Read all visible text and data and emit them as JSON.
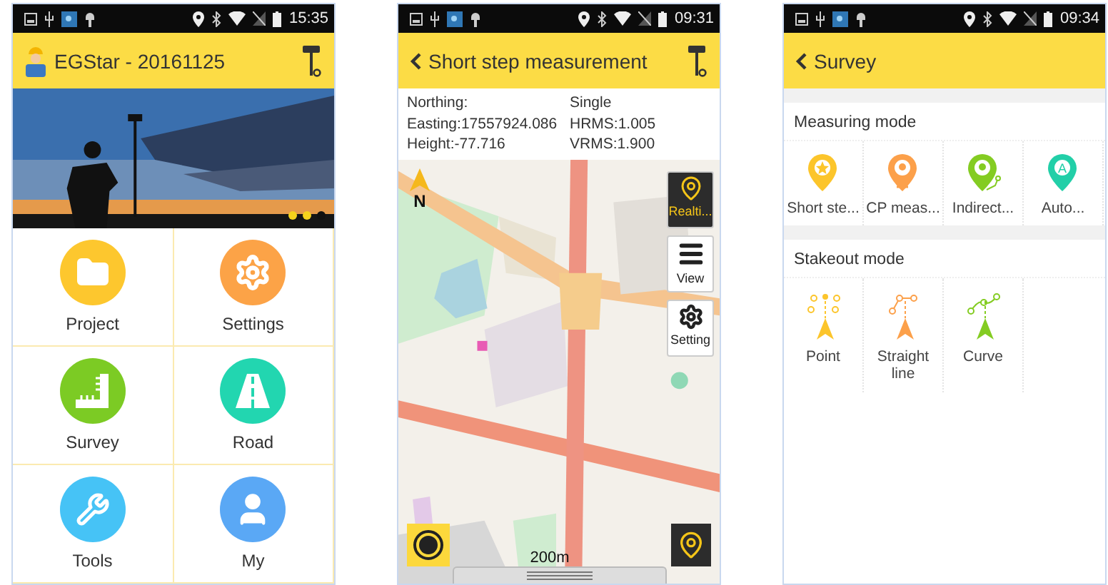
{
  "phones": [
    {
      "kind": "home",
      "status_time": "15:35",
      "title": "EGStar - 20161125",
      "carousel": [
        {
          "selected": false
        },
        {
          "selected": false
        },
        {
          "selected": true
        }
      ],
      "tiles": [
        {
          "label": "Project",
          "kind": "folder",
          "color": "#fdc72e"
        },
        {
          "label": "Settings",
          "kind": "gear",
          "color": "#fca347"
        },
        {
          "label": "Survey",
          "kind": "ruler",
          "color": "#7ccb24"
        },
        {
          "label": "Road",
          "kind": "road",
          "color": "#22d6b0"
        },
        {
          "label": "Tools",
          "kind": "tools",
          "color": "#46c3f6"
        },
        {
          "label": "My",
          "kind": "person",
          "color": "#5aa8f5"
        }
      ]
    },
    {
      "kind": "map",
      "status_time": "09:31",
      "title": "Short step measurement",
      "info": [
        {
          "left": "Northing:",
          "right": "Single"
        },
        {
          "left": "Easting:17557924.086",
          "right": "HRMS:1.005"
        },
        {
          "left": "Height:-77.716",
          "right": "VRMS:1.900"
        }
      ],
      "north": "N",
      "tools": [
        {
          "label": "Realti...",
          "kind": "pin",
          "selected": true
        },
        {
          "label": "View",
          "kind": "layers",
          "selected": false
        },
        {
          "label": "Setting",
          "kind": "gear",
          "selected": false
        }
      ],
      "scale": "200m"
    },
    {
      "kind": "menu",
      "status_time": "09:34",
      "title": "Survey",
      "sections": [
        {
          "title": "Measuring mode",
          "items": [
            {
              "label": "Short ste...",
              "kind": "star-pin",
              "color": "#fcc52b"
            },
            {
              "label": "CP meas...",
              "kind": "target-pin",
              "color": "#fca04a"
            },
            {
              "label": "Indirect...",
              "kind": "path-pin",
              "color": "#84cc22"
            },
            {
              "label": "Auto...",
              "kind": "letter-pin",
              "color": "#22cfa8",
              "letter": "A"
            }
          ]
        },
        {
          "title": "Stakeout mode",
          "items": [
            {
              "label": "Point",
              "kind": "point",
              "color": "#fcc52b"
            },
            {
              "label": "Straight line",
              "kind": "line",
              "color": "#fca04a"
            },
            {
              "label": "Curve",
              "kind": "curve",
              "color": "#84cc22"
            }
          ]
        }
      ]
    }
  ]
}
